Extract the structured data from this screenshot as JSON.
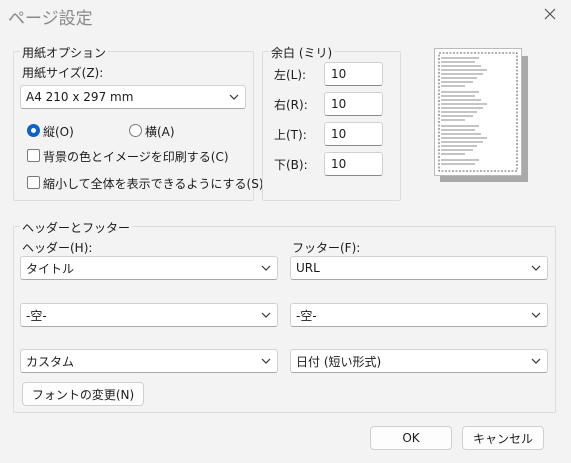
{
  "window": {
    "title": "ページ設定"
  },
  "paper_options": {
    "group_label": "用紙オプション",
    "size_label": "用紙サイズ(Z):",
    "size_value": "A4 210 x 297 mm",
    "portrait_label": "縦(O)",
    "landscape_label": "横(A)",
    "orientation_selected": "portrait",
    "bg_print_label": "背景の色とイメージを印刷する(C)",
    "bg_print_checked": false,
    "shrink_label": "縮小して全体を表示できるようにする(S)",
    "shrink_checked": false
  },
  "margins": {
    "group_label": "余白 (ミリ)",
    "left_label": "左(L):",
    "left_value": "10",
    "right_label": "右(R):",
    "right_value": "10",
    "top_label": "上(T):",
    "top_value": "10",
    "bottom_label": "下(B):",
    "bottom_value": "10"
  },
  "header_footer": {
    "group_label": "ヘッダーとフッター",
    "header_label": "ヘッダー(H):",
    "footer_label": "フッター(F):",
    "header_1": "タイトル",
    "header_2": "-空-",
    "header_3": "カスタム",
    "footer_1": "URL",
    "footer_2": "-空-",
    "footer_3": "日付 (短い形式)",
    "font_button": "フォントの変更(N)"
  },
  "buttons": {
    "ok": "OK",
    "cancel": "キャンセル"
  }
}
